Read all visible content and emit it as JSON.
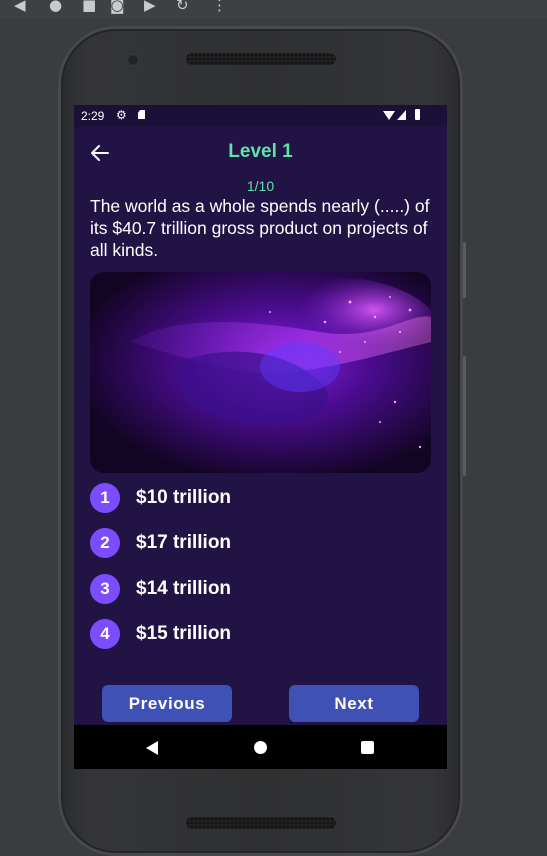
{
  "emulator_toolbar": {
    "icons": [
      "back-triangle-icon",
      "circle-icon",
      "square-icon",
      "camera-icon",
      "video-icon",
      "rotate-icon",
      "more-vert-icon"
    ]
  },
  "status_bar": {
    "time": "2:29",
    "icons": [
      "gear-icon",
      "sd-card-icon",
      "wifi-icon",
      "signal-icon",
      "battery-icon"
    ]
  },
  "header": {
    "title": "Level 1",
    "back_icon": "arrow-left-icon"
  },
  "quiz": {
    "progress": "1/10",
    "question": "The world as a whole spends nearly (.....) of its $40.7 trillion gross product on projects of all kinds.",
    "image": "purple-abstract-swirl",
    "options": [
      {
        "number": "1",
        "label": "$10 trillion"
      },
      {
        "number": "2",
        "label": "$17 trillion"
      },
      {
        "number": "3",
        "label": "$14 trillion"
      },
      {
        "number": "4",
        "label": "$15 trillion"
      }
    ]
  },
  "buttons": {
    "previous": "Previous",
    "next": "Next"
  },
  "nav_bar": {
    "icons": [
      "nav-back-icon",
      "nav-home-icon",
      "nav-recents-icon"
    ]
  },
  "colors": {
    "screen_bg": "#211445",
    "accent_green": "#5fe3a8",
    "option_circle": "#7c4dff",
    "button": "#3f51b5"
  }
}
